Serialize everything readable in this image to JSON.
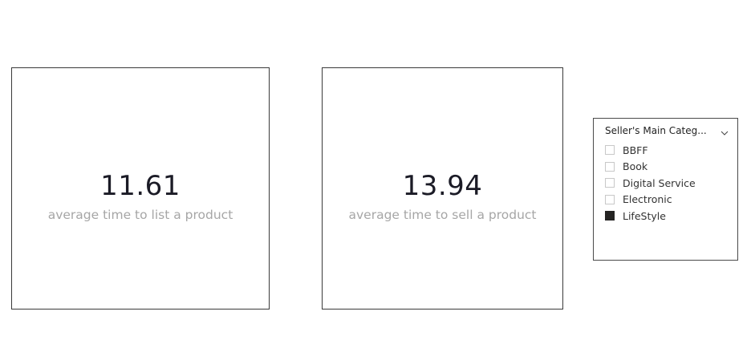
{
  "cards": [
    {
      "value": "11.61",
      "label": "average time to list a product"
    },
    {
      "value": "13.94",
      "label": "average time to sell a product"
    }
  ],
  "slicer": {
    "title": "Seller's Main Categ...",
    "expand_icon": "chevron-down-icon",
    "items": [
      {
        "label": "BBFF",
        "checked": false
      },
      {
        "label": "Book",
        "checked": false
      },
      {
        "label": "Digital Service",
        "checked": false
      },
      {
        "label": "Electronic",
        "checked": false
      },
      {
        "label": "LifeStyle",
        "checked": true
      }
    ]
  },
  "colors": {
    "value_text": "#1b1b26",
    "label_text": "#a6a6a6",
    "card_border": "#3a3a3a",
    "checkbox_checked": "#252423"
  }
}
